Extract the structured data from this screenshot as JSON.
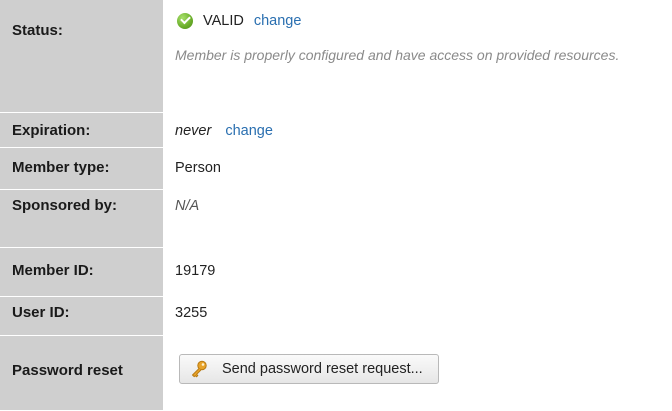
{
  "rows": {
    "status": {
      "label": "Status:",
      "value": "VALID",
      "change": "change",
      "description": "Member is properly configured and have access on provided resources.",
      "icon": "check-circle-icon"
    },
    "expiration": {
      "label": "Expiration:",
      "value": "never",
      "change": "change"
    },
    "member_type": {
      "label": "Member type:",
      "value": "Person"
    },
    "sponsored_by": {
      "label": "Sponsored by:",
      "value": "N/A"
    },
    "member_id": {
      "label": "Member ID:",
      "value": "19179"
    },
    "user_id": {
      "label": "User ID:",
      "value": "3255"
    },
    "password_reset": {
      "label": "Password reset",
      "button": "Send password reset request...",
      "icon": "key-icon"
    }
  },
  "colors": {
    "label_bg": "#cfcfcf",
    "link": "#2a6fb0",
    "valid_green": "#6aad2a",
    "key_orange": "#e8a32a"
  }
}
